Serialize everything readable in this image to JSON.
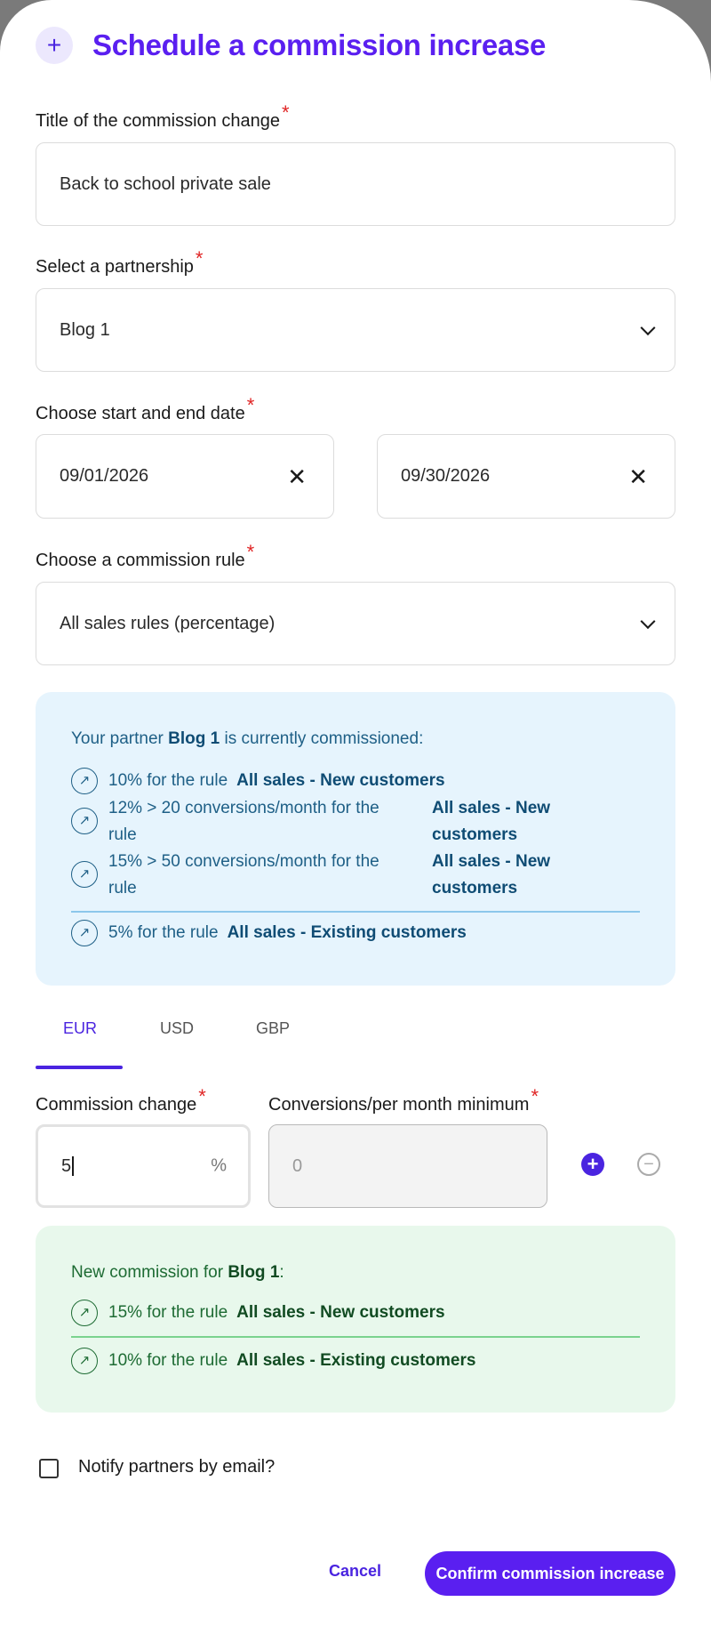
{
  "header": {
    "icon": "plus-icon",
    "title": "Schedule a commission increase"
  },
  "form": {
    "title_label": "Title of the commission change",
    "title_value": "Back to school private sale",
    "partnership_label": "Select a partnership",
    "partnership_value": "Blog 1",
    "dates_label": "Choose start and end date",
    "start_date": "09/01/2026",
    "end_date": "09/30/2026",
    "rule_label": "Choose a commission rule",
    "rule_value": "All sales rules (percentage)",
    "required_mark": "*"
  },
  "current": {
    "intro_prefix": "Your partner",
    "partner": "Blog 1",
    "intro_suffix": "is currently commissioned:",
    "rules": [
      {
        "text": "10% for the rule",
        "rule": "All sales - New customers"
      },
      {
        "text": "12% > 20 conversions/month for the rule",
        "rule": "All sales - New customers"
      },
      {
        "text": "15% > 50 conversions/month for the rule",
        "rule": "All sales - New customers"
      },
      {
        "text": "5% for the rule",
        "rule": "All sales - Existing customers"
      }
    ]
  },
  "tabs": [
    "EUR",
    "USD",
    "GBP"
  ],
  "active_tab": "EUR",
  "change": {
    "commission_label": "Commission change",
    "commission_value": "5",
    "unit": "%",
    "conversions_label": "Conversions/per month minimum",
    "conversions_placeholder": "0"
  },
  "new_commission": {
    "intro_prefix": "New commission for",
    "partner": "Blog 1",
    "colon": ":",
    "rules": [
      {
        "text": "15% for the rule",
        "rule": "All sales - New customers"
      },
      {
        "text": "10% for the rule",
        "rule": "All sales - Existing customers"
      }
    ]
  },
  "notify_label": "Notify partners by email?",
  "notify_checked": false,
  "actions": {
    "cancel": "Cancel",
    "confirm": "Confirm commission increase"
  },
  "colors": {
    "accent": "#5a1ff0",
    "info_bg": "#e6f4fd",
    "success_bg": "#e8f8ec",
    "required": "#e02424"
  }
}
